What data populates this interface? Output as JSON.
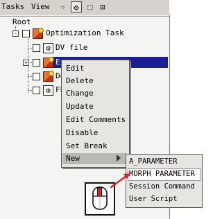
{
  "toolbar": {
    "menus": [
      "Tasks",
      "View"
    ],
    "buttons": [
      {
        "name": "forward-arrow-icon",
        "glyph": "⇨",
        "color": "#2a54c9"
      },
      {
        "name": "gear-icon",
        "glyph": "⚙"
      },
      {
        "name": "fit-view-icon",
        "glyph": "⬚"
      },
      {
        "name": "zoom-box-icon",
        "glyph": "⊡"
      }
    ]
  },
  "tree": {
    "root_label": "Root",
    "nodes": [
      {
        "label": "Optimization Task",
        "icon": "task-icon"
      },
      {
        "label": "DV file",
        "icon": "gear-icon"
      },
      {
        "label": "Ex...",
        "icon": "task-icon",
        "selected": true
      },
      {
        "label": "De",
        "icon": "task-icon"
      },
      {
        "label": "FE",
        "icon": "gear-icon"
      }
    ]
  },
  "context_menu": {
    "items": [
      "Edit",
      "Delete",
      "Change",
      "Update",
      "Edit Comments",
      "Disable",
      "Set Break",
      "New"
    ],
    "active_item": "New"
  },
  "submenu": {
    "items": [
      "A_PARAMETER",
      "MORPH PARAMETER",
      "Session Command",
      "User Script"
    ],
    "highlighted": "MORPH PARAMETER"
  },
  "colors": {
    "selection": "#1a1f96",
    "annotation_arrow": "#e02020",
    "mouse_button": "#d62a2a"
  }
}
